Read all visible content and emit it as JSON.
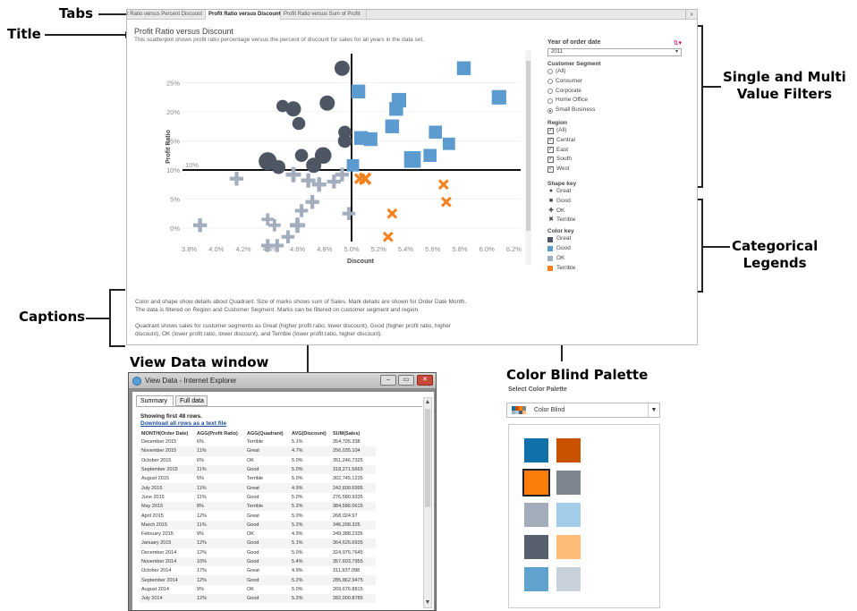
{
  "callouts": {
    "tabs": "Tabs",
    "title": "Title",
    "filters": [
      "Single and Multi",
      "Value Filters"
    ],
    "legends": [
      "Categorical",
      "Legends"
    ],
    "captions": "Captions",
    "view_data": "View Data window",
    "palette": "Color Blind Palette"
  },
  "tabs": [
    {
      "label": "Profit Ratio versus Percent Discount"
    },
    {
      "label": "Profit Ratio versus Discount"
    },
    {
      "label": "Profit Ratio versus Sum of Profit"
    }
  ],
  "tab_scroll": "›",
  "sheet": {
    "title": "Profit Ratio versus Discount",
    "subtitle": "This scatterplot shows profit ratio percentage versus the percent of discount for sales for all years in the data set."
  },
  "captions": [
    "Color and shape show details about Quadrant. Size of marks shows sum of Sales. Mark details are shown for Order Date Month.",
    "The data is filtered on Region and Customer Segment. Marks can be filtered on customer segment and region.",
    "Quadrant shows sales for customer segments as Great (higher profit ratio, lower discount), Good (higher profit ratio, higher",
    "discount), OK (lower profit ratio, lower discount), and Terrible (lower profit ratio, higher discount)."
  ],
  "filters": {
    "year_label": "Year of order date",
    "year_value": "2011",
    "segment_label": "Customer Segment",
    "segments": [
      {
        "label": "(All)",
        "selected": false
      },
      {
        "label": "Consumer",
        "selected": false
      },
      {
        "label": "Corporate",
        "selected": false
      },
      {
        "label": "Home Office",
        "selected": false
      },
      {
        "label": "Small Business",
        "selected": true
      }
    ],
    "region_label": "Region",
    "regions": [
      {
        "label": "(All)",
        "checked": true
      },
      {
        "label": "Central",
        "checked": true
      },
      {
        "label": "East",
        "checked": true
      },
      {
        "label": "South",
        "checked": true
      },
      {
        "label": "West",
        "checked": true
      }
    ]
  },
  "legends": {
    "shape_label": "Shape key",
    "shapes": [
      {
        "label": "Great",
        "glyph": "●"
      },
      {
        "label": "Good",
        "glyph": "■"
      },
      {
        "label": "OK",
        "glyph": "✚"
      },
      {
        "label": "Terrible",
        "glyph": "✖"
      }
    ],
    "color_label": "Color key",
    "colors": [
      {
        "label": "Great",
        "color": "#4f5663"
      },
      {
        "label": "Good",
        "color": "#5b9bd0"
      },
      {
        "label": "OK",
        "color": "#a2adbe"
      },
      {
        "label": "Terrible",
        "color": "#f5821f"
      }
    ]
  },
  "chart_data": {
    "type": "scatter",
    "title": "Profit Ratio versus Discount",
    "xlabel": "Discount",
    "ylabel": "Profit Ratio",
    "xlim": [
      3.75,
      6.25
    ],
    "ylim": [
      -2,
      30
    ],
    "xticks": [
      "3.8%",
      "4.0%",
      "4.2%",
      "4.4%",
      "4.6%",
      "4.8%",
      "5.0%",
      "5.2%",
      "5.4%",
      "5.6%",
      "5.8%",
      "6.0%",
      "6.2%"
    ],
    "yticks": [
      "0%",
      "5%",
      "10%",
      "15%",
      "20%",
      "25%"
    ],
    "reference_lines": {
      "x": 5.0,
      "y": 10,
      "y_label": "10%"
    },
    "series": [
      {
        "name": "Great",
        "shape": "circle",
        "color": "#4f5663",
        "points": [
          [
            4.93,
            27.5,
            1.0
          ],
          [
            4.82,
            21.5,
            1.0
          ],
          [
            4.95,
            16.5,
            0.7
          ],
          [
            4.95,
            15,
            0.8
          ],
          [
            4.79,
            12.5,
            1.2
          ],
          [
            4.72,
            10.8,
            1.0
          ],
          [
            4.63,
            12.5,
            0.7
          ],
          [
            4.49,
            21,
            0.6
          ],
          [
            4.57,
            20.5,
            1.0
          ],
          [
            4.38,
            11.5,
            1.4
          ],
          [
            4.46,
            10.5,
            0.8
          ],
          [
            4.61,
            18,
            0.7
          ]
        ]
      },
      {
        "name": "Good",
        "shape": "square",
        "color": "#5b9bd0",
        "points": [
          [
            5.83,
            27.5,
            0.8
          ],
          [
            5.05,
            23.5,
            0.8
          ],
          [
            5.35,
            22,
            0.9
          ],
          [
            5.33,
            20.5,
            0.8
          ],
          [
            5.3,
            17.5,
            0.8
          ],
          [
            5.07,
            15.5,
            0.8
          ],
          [
            5.14,
            15.3,
            0.8
          ],
          [
            5.62,
            16.5,
            0.7
          ],
          [
            5.72,
            14.5,
            0.6
          ],
          [
            5.45,
            11.8,
            1.2
          ],
          [
            5.58,
            12.5,
            0.7
          ],
          [
            6.09,
            22.5,
            0.9
          ],
          [
            5.01,
            10.8,
            0.6
          ]
        ]
      },
      {
        "name": "OK",
        "shape": "cross",
        "color": "#a2adbe",
        "points": [
          [
            4.15,
            8.5,
            0.8
          ],
          [
            4.57,
            9.2,
            1.0
          ],
          [
            4.68,
            8.2,
            0.9
          ],
          [
            4.76,
            7.5,
            0.9
          ],
          [
            4.87,
            8.0,
            0.8
          ],
          [
            4.93,
            9.2,
            0.8
          ],
          [
            4.71,
            4.5,
            0.8
          ],
          [
            4.63,
            3.0,
            0.7
          ],
          [
            4.98,
            2.5,
            0.7
          ],
          [
            4.38,
            1.5,
            0.6
          ],
          [
            4.43,
            0.5,
            0.6
          ],
          [
            4.6,
            0.5,
            1.0
          ],
          [
            3.88,
            0.5,
            0.8
          ],
          [
            4.53,
            -1.5,
            0.7
          ],
          [
            4.45,
            -3.0,
            0.7
          ],
          [
            4.38,
            -3.0,
            0.7
          ]
        ]
      },
      {
        "name": "Terrible",
        "shape": "x",
        "color": "#f5821f",
        "points": [
          [
            5.1,
            8.5,
            1.0
          ],
          [
            5.06,
            8.5,
            0.7
          ],
          [
            5.68,
            7.5,
            0.6
          ],
          [
            5.7,
            4.5,
            0.6
          ],
          [
            5.3,
            2.5,
            0.6
          ],
          [
            5.27,
            -1.5,
            0.6
          ]
        ]
      }
    ]
  },
  "view_data": {
    "window_title": "View Data - Internet Explorer",
    "tabs": [
      "Summary",
      "Full data"
    ],
    "showing": "Showing first 48 rows.",
    "download_link": "Download all rows as a text file",
    "columns": [
      "MONTH(Order Date)",
      "AGG(Profit Ratio)",
      "AGG(Quadrant)",
      "AVG(Discount)",
      "SUM(Sales)"
    ],
    "rows": [
      [
        "December 2015",
        "6%",
        "Terrible",
        "5.1%",
        "354,705.338"
      ],
      [
        "November 2015",
        "11%",
        "Great",
        "4.7%",
        "256,035.104"
      ],
      [
        "October 2015",
        "6%",
        "OK",
        "5.0%",
        "351,246.7325"
      ],
      [
        "September 2015",
        "11%",
        "Good",
        "5.0%",
        "318,271.5665"
      ],
      [
        "August 2015",
        "5%",
        "Terrible",
        "5.0%",
        "302,745.1235"
      ],
      [
        "July 2015",
        "11%",
        "Great",
        "4.9%",
        "242,609.6995"
      ],
      [
        "June 2015",
        "11%",
        "Good",
        "5.0%",
        "276,580.9335"
      ],
      [
        "May 2015",
        "8%",
        "Terrible",
        "5.2%",
        "384,586.0615"
      ],
      [
        "April 2015",
        "12%",
        "Great",
        "5.0%",
        "268,024.97"
      ],
      [
        "March 2015",
        "11%",
        "Good",
        "5.2%",
        "346,208.325"
      ],
      [
        "February 2015",
        "9%",
        "OK",
        "4.9%",
        "249,388.2335"
      ],
      [
        "January 2015",
        "12%",
        "Good",
        "5.1%",
        "364,626.6935"
      ],
      [
        "December 2014",
        "12%",
        "Good",
        "5.0%",
        "324,975.7645"
      ],
      [
        "November 2014",
        "10%",
        "Good",
        "5.4%",
        "357,603.7955"
      ],
      [
        "October 2014",
        "17%",
        "Great",
        "4.9%",
        "311,937.098"
      ],
      [
        "September 2014",
        "12%",
        "Good",
        "5.2%",
        "285,862.9475"
      ],
      [
        "August 2014",
        "9%",
        "OK",
        "5.0%",
        "269,676.8815"
      ],
      [
        "July 2014",
        "12%",
        "Good",
        "5.2%",
        "282,000.8785"
      ]
    ],
    "buttons": {
      "minimize": "–",
      "maximize": "▭",
      "close": "✕"
    }
  },
  "palette": {
    "label": "Select Color Palette",
    "selected": "Color Blind",
    "dropdown_glyph": "▼",
    "swatches": [
      "#1170aa",
      "#c85200",
      "#fc7d0b",
      "#7b848f",
      "#a3acb9",
      "#a3cce9",
      "#57606c",
      "#ffbc79",
      "#5fa2ce",
      "#c8d0d9"
    ],
    "selected_index": 2
  }
}
